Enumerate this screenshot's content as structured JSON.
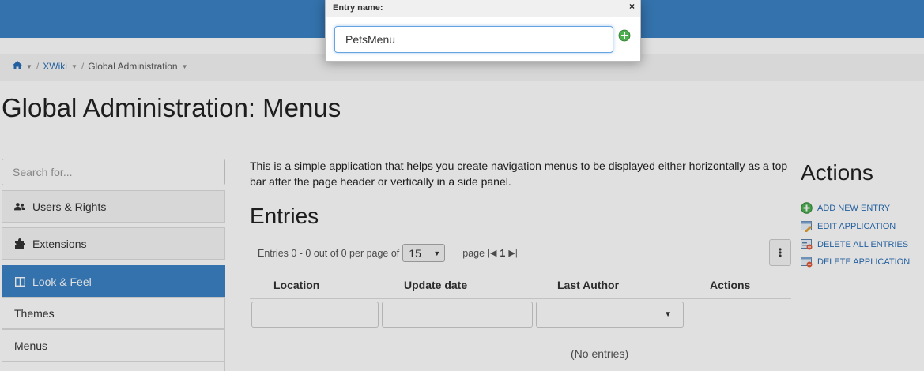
{
  "breadcrumb": {
    "home_icon": "home-icon",
    "items": [
      "XWiki",
      "Global Administration"
    ],
    "separator": "/"
  },
  "page": {
    "title": "Global Administration: Menus"
  },
  "sidebar": {
    "search_placeholder": "Search for...",
    "items": [
      {
        "label": "Users & Rights",
        "icon": "users-icon"
      },
      {
        "label": "Extensions",
        "icon": "puzzle-icon"
      },
      {
        "label": "Look & Feel",
        "icon": "columns-icon",
        "active": true
      },
      {
        "label": "Themes"
      },
      {
        "label": "Menus"
      }
    ]
  },
  "main": {
    "intro": "This is a simple application that helps you create navigation menus to be displayed either horizontally as a top bar after the page header or vertically in a side panel.",
    "entries_title": "Entries",
    "pager": {
      "entries_text": "Entries 0 - 0 out of 0 per page of",
      "per_page": "15",
      "page_label": "page",
      "page_number": "1"
    },
    "table": {
      "columns": [
        "Location",
        "Update date",
        "Last Author",
        "Actions"
      ],
      "empty_text": "(No entries)"
    }
  },
  "actions": {
    "title": "Actions",
    "items": [
      {
        "label": "ADD NEW ENTRY",
        "icon": "add-icon"
      },
      {
        "label": "EDIT APPLICATION",
        "icon": "edit-app-icon"
      },
      {
        "label": "DELETE ALL ENTRIES",
        "icon": "delete-entries-icon"
      },
      {
        "label": "DELETE APPLICATION",
        "icon": "delete-app-icon"
      }
    ]
  },
  "popup": {
    "title": "Entry name:",
    "close": "×",
    "input_value": "PetsMenu"
  },
  "colors": {
    "brand": "#3b82c4",
    "link": "#2a6eb5",
    "add_green": "#4caf50"
  }
}
